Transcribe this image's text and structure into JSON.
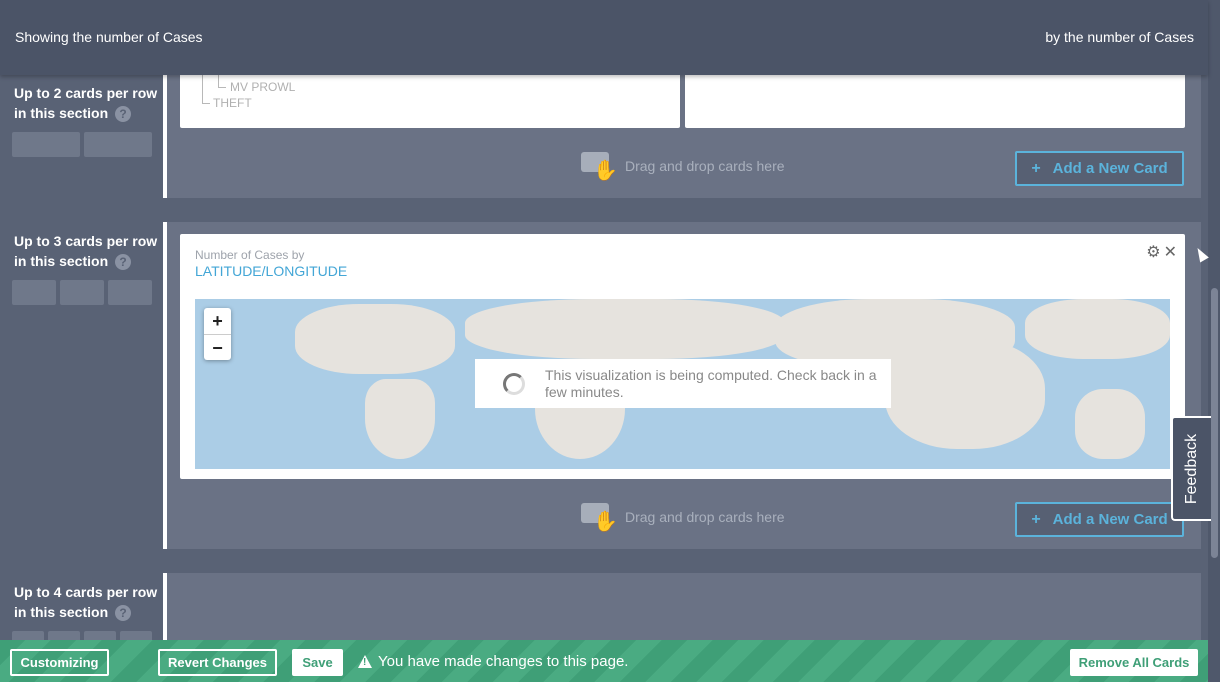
{
  "header": {
    "left_text": "Showing the number of Cases",
    "right_text": "by the number of Cases"
  },
  "sections": [
    {
      "label": "Up to 2 cards per row in this section",
      "help": "?"
    },
    {
      "label": "Up to 3 cards per row in this section",
      "help": "?"
    },
    {
      "label": "Up to 4 cards per row in this section",
      "help": "?"
    }
  ],
  "section1": {
    "tree_items": [
      "MV PROWL",
      "THEFT"
    ],
    "drop_text": "Drag and drop cards here",
    "add_card": "Add a New Card"
  },
  "section2": {
    "card_subtitle": "Number of Cases by",
    "card_title": "LATITUDE/LONGITUDE",
    "zoom_in": "+",
    "zoom_out": "−",
    "computing_msg": "This visualization is being computed. Check back in a few minutes.",
    "drop_text": "Drag and drop cards here",
    "add_card": "Add a New Card"
  },
  "feedback": "Feedback",
  "bottom_bar": {
    "customizing": "Customizing",
    "revert": "Revert Changes",
    "save": "Save",
    "changes_msg": "You have made changes to this page.",
    "remove_all": "Remove All Cards"
  },
  "colors": {
    "background": "#596275",
    "accent": "#5bb3db",
    "save_bar": "#3f9f77"
  }
}
